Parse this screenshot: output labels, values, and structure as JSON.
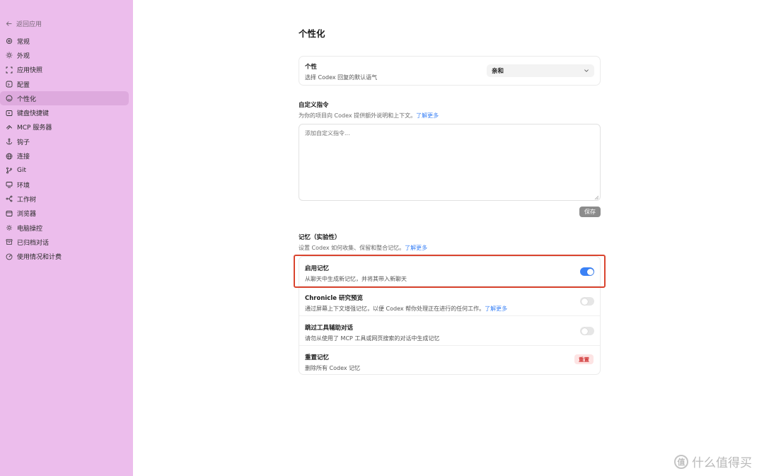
{
  "sidebar": {
    "back_label": "返回应用",
    "items": [
      {
        "label": "常规",
        "icon": "gear-icon"
      },
      {
        "label": "外观",
        "icon": "sun-icon"
      },
      {
        "label": "应用快照",
        "icon": "snapshot-icon"
      },
      {
        "label": "配置",
        "icon": "config-icon"
      },
      {
        "label": "个性化",
        "icon": "personalization-icon"
      },
      {
        "label": "键盘快捷键",
        "icon": "keyboard-icon"
      },
      {
        "label": "MCP 服务器",
        "icon": "mcp-icon"
      },
      {
        "label": "钩子",
        "icon": "anchor-icon"
      },
      {
        "label": "连接",
        "icon": "globe-icon"
      },
      {
        "label": "Git",
        "icon": "git-branch-icon"
      },
      {
        "label": "环境",
        "icon": "monitor-icon"
      },
      {
        "label": "工作树",
        "icon": "worktree-icon"
      },
      {
        "label": "浏览器",
        "icon": "browser-icon"
      },
      {
        "label": "电脑操控",
        "icon": "computer-control-icon"
      },
      {
        "label": "已归档对话",
        "icon": "archive-icon"
      },
      {
        "label": "使用情况和计费",
        "icon": "gauge-icon"
      }
    ],
    "active_index": 4
  },
  "page": {
    "title": "个性化"
  },
  "personality": {
    "title": "个性",
    "description": "选择 Codex 回复的默认语气",
    "selected": "亲和"
  },
  "custom_instructions": {
    "title": "自定义指令",
    "description": "为你的项目向 Codex 提供额外说明和上下文。",
    "link": "了解更多",
    "placeholder": "添加自定义指令...",
    "save_label": "保存"
  },
  "memory": {
    "title": "记忆（实验性）",
    "description": "设置 Codex 如何收集、保留和整合记忆。",
    "link": "了解更多",
    "rows": [
      {
        "title": "启用记忆",
        "description": "从聊天中生成新记忆，并将其带入新聊天",
        "toggle": true
      },
      {
        "title": "Chronicle 研究预览",
        "description": "通过屏幕上下文增强记忆，以便 Codex 帮你处理正在进行的任何工作。",
        "link": "了解更多",
        "toggle": false
      },
      {
        "title": "跳过工具辅助对话",
        "description": "请勿从使用了 MCP 工具或网页搜索的对话中生成记忆",
        "toggle": false
      },
      {
        "title": "重置记忆",
        "description": "删除所有 Codex 记忆",
        "button": "重置"
      }
    ]
  },
  "watermark": {
    "logo_text": "值",
    "text": "什么值得买"
  },
  "colors": {
    "sidebar_bg": "#ecbdec",
    "accent": "#3b82f6",
    "highlight": "#d9442e",
    "danger": "#d23b3b"
  }
}
